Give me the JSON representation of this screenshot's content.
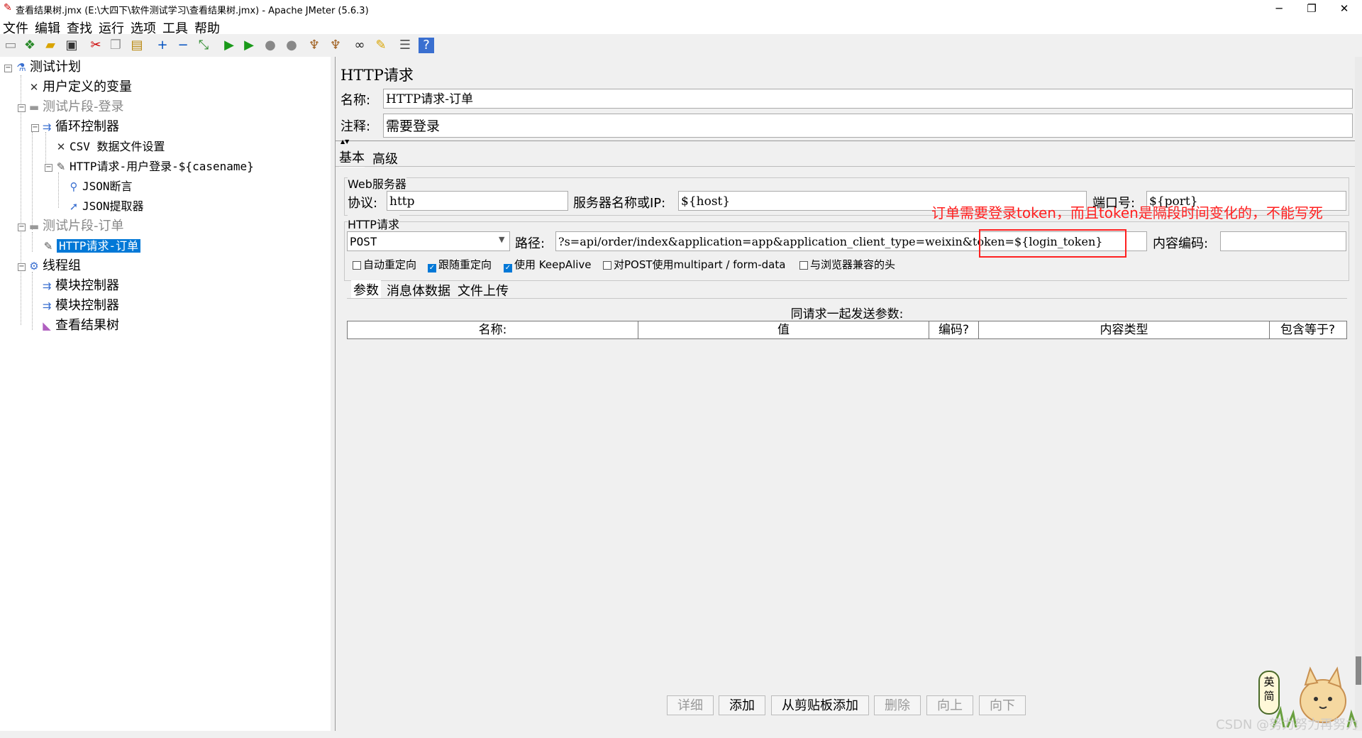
{
  "window": {
    "title": "查看结果树.jmx (E:\\大四下\\软件测试学习\\查看结果树.jmx) - Apache JMeter (5.6.3)",
    "minimize": "─",
    "restore": "❐",
    "close": "✕"
  },
  "menu": [
    "文件",
    "编辑",
    "查找",
    "运行",
    "选项",
    "工具",
    "帮助"
  ],
  "toolbar_icons": [
    "new-icon",
    "templates-icon",
    "open-icon",
    "save-icon",
    "cut-icon",
    "copy-icon",
    "paste-icon",
    "expand-icon",
    "collapse-icon",
    "toggle-icon",
    "start-icon",
    "start-no-pause-icon",
    "stop-icon",
    "shutdown-icon",
    "clear-icon",
    "clear-all-icon",
    "search-icon",
    "reset-search-icon",
    "function-helper-icon",
    "help-icon"
  ],
  "tree": [
    {
      "label": "测试计划"
    },
    {
      "label": "用户定义的变量"
    },
    {
      "label": "测试片段-登录"
    },
    {
      "label": "循环控制器"
    },
    {
      "label": "CSV 数据文件设置"
    },
    {
      "label": "HTTP请求-用户登录-${casename}"
    },
    {
      "label": "JSON断言"
    },
    {
      "label": "JSON提取器"
    },
    {
      "label": "测试片段-订单"
    },
    {
      "label": "HTTP请求-订单"
    },
    {
      "label": "线程组"
    },
    {
      "label": "模块控制器"
    },
    {
      "label": "模块控制器"
    },
    {
      "label": "查看结果树"
    }
  ],
  "panel": {
    "title": "HTTP请求",
    "name_label": "名称:",
    "name_value": "HTTP请求-订单",
    "comment_label": "注释:",
    "comment_value": "需要登录",
    "tabs": [
      "基本",
      "高级"
    ],
    "web_server": {
      "group_title": "Web服务器",
      "protocol_label": "协议:",
      "protocol_value": "http",
      "server_label": "服务器名称或IP:",
      "server_value": "${host}",
      "port_label": "端口号:",
      "port_value": "${port}"
    },
    "http_request": {
      "group_title": "HTTP请求",
      "method": "POST",
      "path_label": "路径:",
      "path_value": "?s=api/order/index&application=app&application_client_type=weixin&token=${login_token}",
      "encoding_label": "内容编码:",
      "encoding_value": ""
    },
    "checkboxes": [
      {
        "label": "自动重定向",
        "checked": false
      },
      {
        "label": "跟随重定向",
        "checked": true
      },
      {
        "label": "使用 KeepAlive",
        "checked": true
      },
      {
        "label": "对POST使用multipart / form-data",
        "checked": false
      },
      {
        "label": "与浏览器兼容的头",
        "checked": false
      }
    ],
    "subtabs": [
      "参数",
      "消息体数据",
      "文件上传"
    ],
    "params_caption": "同请求一起发送参数:",
    "columns": [
      "名称:",
      "值",
      "编码?",
      "内容类型",
      "包含等于?"
    ],
    "buttons": [
      {
        "label": "详细",
        "enabled": false
      },
      {
        "label": "添加",
        "enabled": true
      },
      {
        "label": "从剪贴板添加",
        "enabled": true
      },
      {
        "label": "删除",
        "enabled": false
      },
      {
        "label": "向上",
        "enabled": false
      },
      {
        "label": "向下",
        "enabled": false
      }
    ]
  },
  "annotation": "订单需要登录token，而且token是隔段时间变化的，不能写死",
  "watermark": "CSDN @努力努力再努力",
  "ime_badge": "英简",
  "colors": {
    "selection": "#0078d7",
    "annotation": "#ff2020",
    "background": "#f0f0f0"
  }
}
